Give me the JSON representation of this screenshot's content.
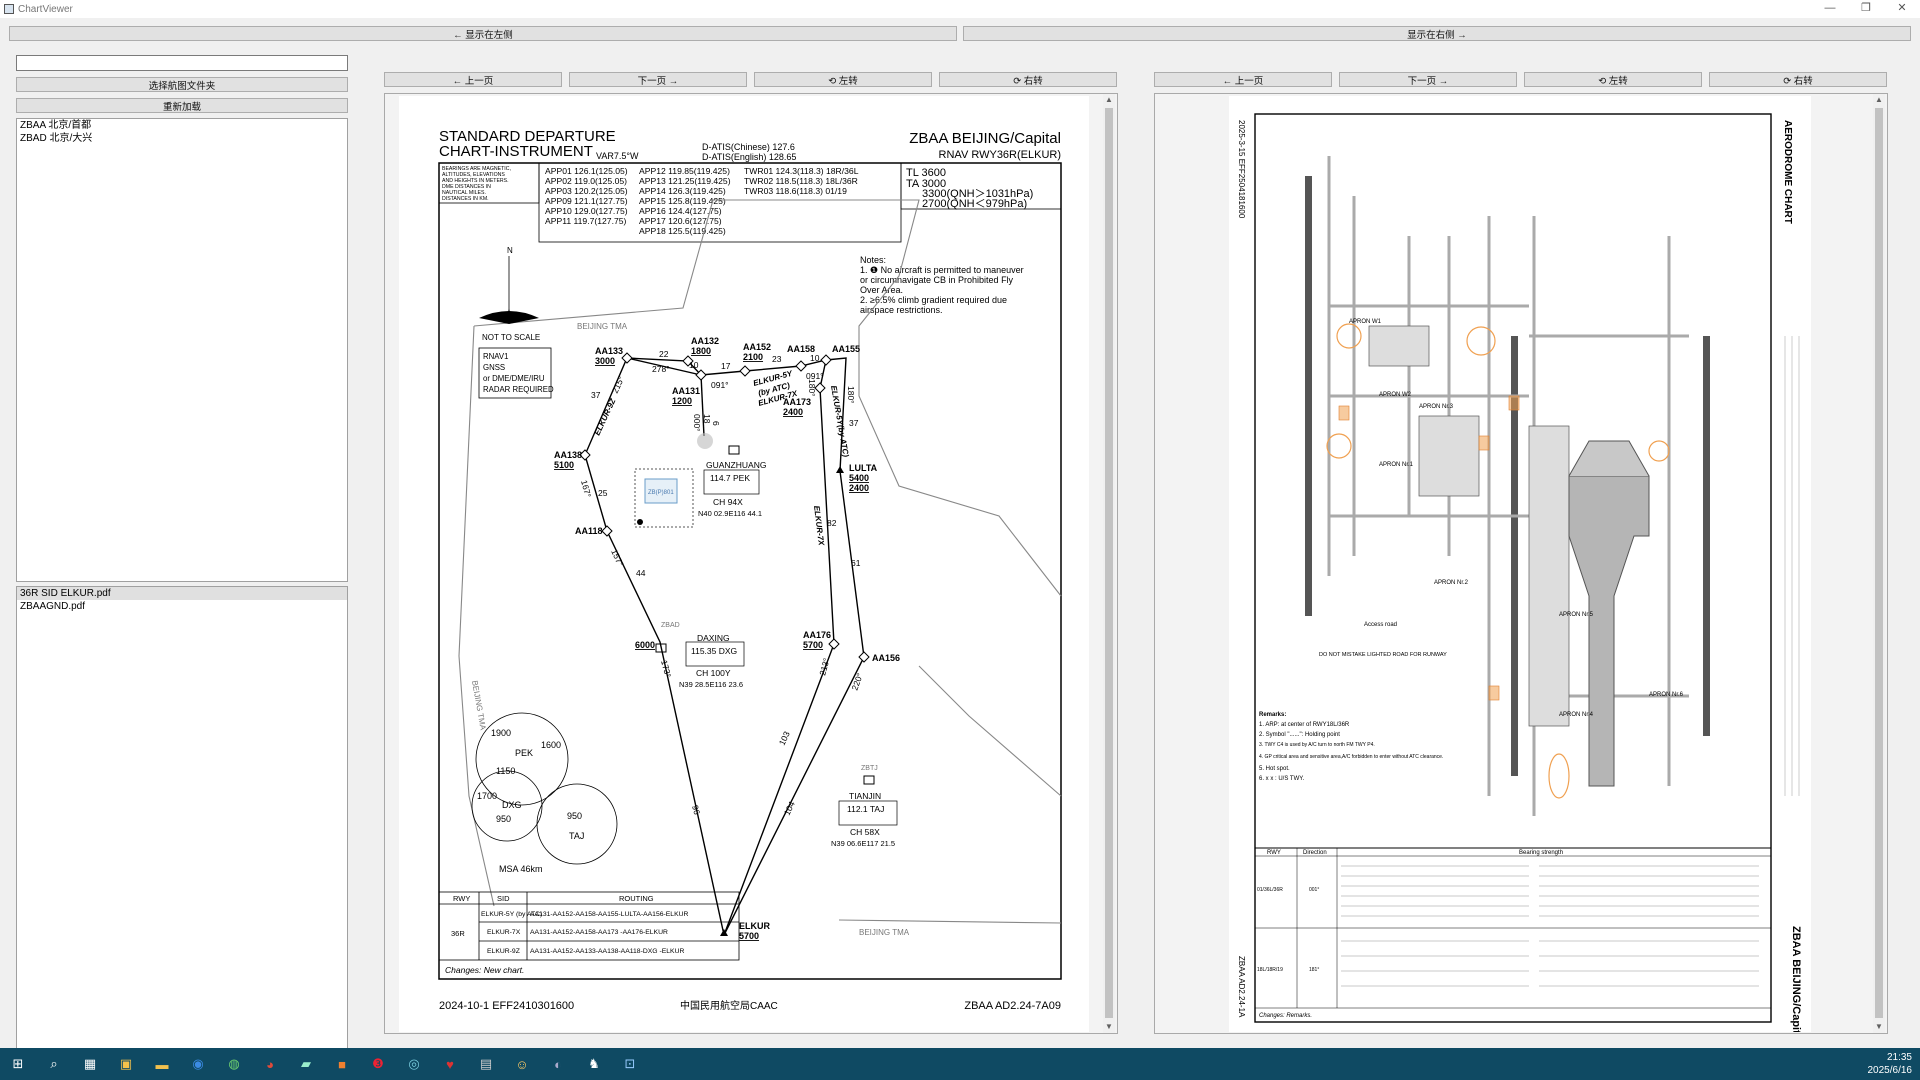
{
  "window": {
    "title": "ChartViewer"
  },
  "top_buttons": {
    "show_left": "← 显示在左侧",
    "show_right": "显示在右侧 →"
  },
  "sidebar": {
    "search_placeholder": "",
    "select_folder": "选择航图文件夹",
    "reload": "重新加载",
    "airports": [
      "ZBAA 北京/首都",
      "ZBAD 北京/大兴"
    ],
    "files": [
      "36R SID ELKUR.pdf",
      "ZBAAGND.pdf"
    ]
  },
  "left_viewer": {
    "prev": "← 上一页",
    "next": "下一页 →",
    "rotate_left": "⟲ 左转",
    "rotate_right": "⟳ 右转"
  },
  "right_viewer": {
    "prev": "← 上一页",
    "next": "下一页 →",
    "rotate_left": "⟲ 左转",
    "rotate_right": "⟳ 右转"
  },
  "sid_chart": {
    "title1": "STANDARD DEPARTURE",
    "title2": "CHART-INSTRUMENT",
    "var": "VAR7.5°W",
    "atis1": "D-ATIS(Chinese) 127.6",
    "atis2": "D-ATIS(English) 128.65",
    "airport": "ZBAA BEIJING/Capital",
    "procedure": "RNAV RWY36R(ELKUR)",
    "bearings_note": [
      "BEARINGS ARE MAGNETIC,",
      "ALTITUDES, ELEVATIONS",
      "AND HEIGHTS IN METERS.",
      "DME DISTANCES IN",
      "NAUTICAL MILES.",
      "DISTANCES IN KM."
    ],
    "freq_col1": [
      "APP01 126.1(125.05)",
      "APP02 119.0(125.05)",
      "APP03 120.2(125.05)",
      "APP09 121.1(127.75)",
      "APP10 129.0(127.75)",
      "APP11 119.7(127.75)"
    ],
    "freq_col2": [
      "APP12 119.85(119.425)",
      "APP13 121.25(119.425)",
      "APP14 126.3(119.425)",
      "APP15 125.8(119.425)",
      "APP16 124.4(127.75)",
      "APP17 120.6(127.75)",
      "APP18 125.5(119.425)"
    ],
    "freq_col3": [
      "TWR01 124.3(118.3) 18R/36L",
      "TWR02 118.5(118.3) 18L/36R",
      "TWR03 118.6(118.3) 01/19"
    ],
    "tl": "TL 3600",
    "ta": "TA 3000",
    "qnh1": "3300(QNH＞1031hPa)",
    "qnh2": "2700(QNH＜979hPa)",
    "notes": [
      "Notes:",
      "1. ❶ No aircraft is permitted to maneuver",
      "or circumnavigate CB in Prohibited Fly",
      "Over Area.",
      "2. ≥6.5% climb gradient required due",
      "airspace restrictions."
    ],
    "north": "N",
    "not_to_scale": "NOT TO SCALE",
    "rnav_box": [
      "RNAV1",
      "GNSS",
      "or DME/DME/IRU",
      "RADAR REQUIRED"
    ],
    "tma1": "BEIJING TMA",
    "tma2": "BEIJING TMA",
    "tma3": "BEIJING TMA",
    "waypoints": {
      "aa133": "AA133",
      "aa133_alt": "3000",
      "aa132": "AA132",
      "aa132_alt": "1800",
      "aa152": "AA152",
      "aa152_alt": "2100",
      "aa158": "AA158",
      "aa155": "AA155",
      "aa131": "AA131",
      "aa131_alt": "1200",
      "aa173": "AA173",
      "aa173_alt": "2400",
      "aa138": "AA138",
      "aa138_alt": "5100",
      "aa118": "AA118",
      "aa176": "AA176",
      "aa176_alt": "5700",
      "aa156": "AA156",
      "lulta": "LULTA",
      "lulta_alt1": "5400",
      "lulta_alt2": "2400",
      "elkur": "ELKUR",
      "elkur_alt": "5700",
      "alt6000": "6000"
    },
    "legs": {
      "d22": "22",
      "c278": "278°",
      "d17": "17",
      "d23": "23",
      "c091a": "091°",
      "c091b": "091°",
      "d10a": "10",
      "d10b": "10",
      "c180a": "180°",
      "c180b": "180°",
      "c000": "000°",
      "d37a": "37",
      "d37b": "37",
      "c215": "215°",
      "d25": "25",
      "c167": "167°",
      "d44": "44",
      "c157": "157°",
      "d82": "82",
      "d61": "61",
      "c173": "173°",
      "c213": "213°",
      "c220": "220°",
      "d103": "103",
      "d96": "96",
      "d104": "104",
      "d6": "6",
      "d18": "18",
      "elkur92": "ELKUR-9Z",
      "elkur5y": "ELKUR-5Y",
      "byatc": "(by ATC)",
      "elkur7x": "ELKUR-7X",
      "elkur5y_atc": "ELKUR-5Y(by ATC)",
      "elkur7x_b": "ELKUR-7X"
    },
    "navaids": {
      "pek_name": "GUANZHUANG",
      "pek_freq": "114.7 PEK",
      "pek_ch": "CH 94X",
      "pek_pos": "N40 02.9E116 44.1",
      "dxg_name": "DAXING",
      "dxg_freq": "115.35 DXG",
      "dxg_ch": "CH 100Y",
      "dxg_pos": "N39 28.5E116 23.6",
      "taj_name": "TIANJIN",
      "taj_freq": "112.1 TAJ",
      "taj_ch": "CH 58X",
      "taj_pos": "N39 06.6E117 21.5",
      "zbad": "ZBAD",
      "zbtj": "ZBTJ",
      "zbp": "ZB(P)801"
    },
    "msa": {
      "a1900": "1900",
      "a1600": "1600",
      "a1150": "1150",
      "a1700": "1700",
      "a950a": "950",
      "a950b": "950",
      "pek": "PEK",
      "dxg": "DXG",
      "taj": "TAJ",
      "label": "MSA 46km"
    },
    "table": {
      "headers": [
        "RWY",
        "SID",
        "ROUTING"
      ],
      "rwy": "36R",
      "rows": [
        [
          "ELKUR-5Y (by ATC)",
          "AA131-AA152-AA158-AA155-LULTA-AA156-ELKUR"
        ],
        [
          "ELKUR-7X",
          "AA131-AA152-AA158-AA173   -AA176-ELKUR"
        ],
        [
          "ELKUR-9Z",
          "AA131-AA152-AA133-AA138-AA118-DXG   -ELKUR"
        ]
      ]
    },
    "changes": "Changes: New chart.",
    "footer_left": "2024-10-1 EFF2410301600",
    "footer_mid": "中国民用航空局CAAC",
    "footer_right": "ZBAA AD2.24-7A09"
  },
  "ad_chart": {
    "title": "AERODROME CHART",
    "airport": "ZBAA BEIJING/Capital",
    "page_id": "ZBAA AD2.24-1A",
    "eff": "2025-3-15 EFF2504181600",
    "remarks_title": "Remarks:",
    "remarks": [
      "1. ARP: at center of RWY18L/36R",
      "2. Symbol \"......\": Holding point",
      "3. TWY C4 is used by A/C turn to north FM TWY P4.",
      "4. GP critical area and sensitive area,A/C forbidden to enter without ATC clearance.",
      "5. Hot spot.",
      "6. x x : U/S TWY."
    ],
    "strength_headers": [
      "RWY",
      "Direction",
      "Bearing strength"
    ],
    "strength_rows": [
      [
        "01/36L/36R",
        "001°"
      ],
      [
        "18L/18R/19",
        "181°"
      ]
    ],
    "changes": "Changes: Remarks.",
    "access_road": "Access road",
    "do_not_mistake": "DO NOT MISTAKE LIGHTED ROAD FOR RUNWAY",
    "aprons": [
      "APRON W1",
      "APRON W2",
      "APRON Nr.3",
      "APRON Nr.2",
      "APRON Nr.1",
      "APRON Nr.4",
      "APRON Nr.5",
      "APRON Nr.6"
    ]
  },
  "taskbar": {
    "time": "21:35",
    "date": "2025/6/16"
  },
  "colors": {
    "taskbar": "#0f4a63",
    "hotspot": "#f0a050"
  }
}
